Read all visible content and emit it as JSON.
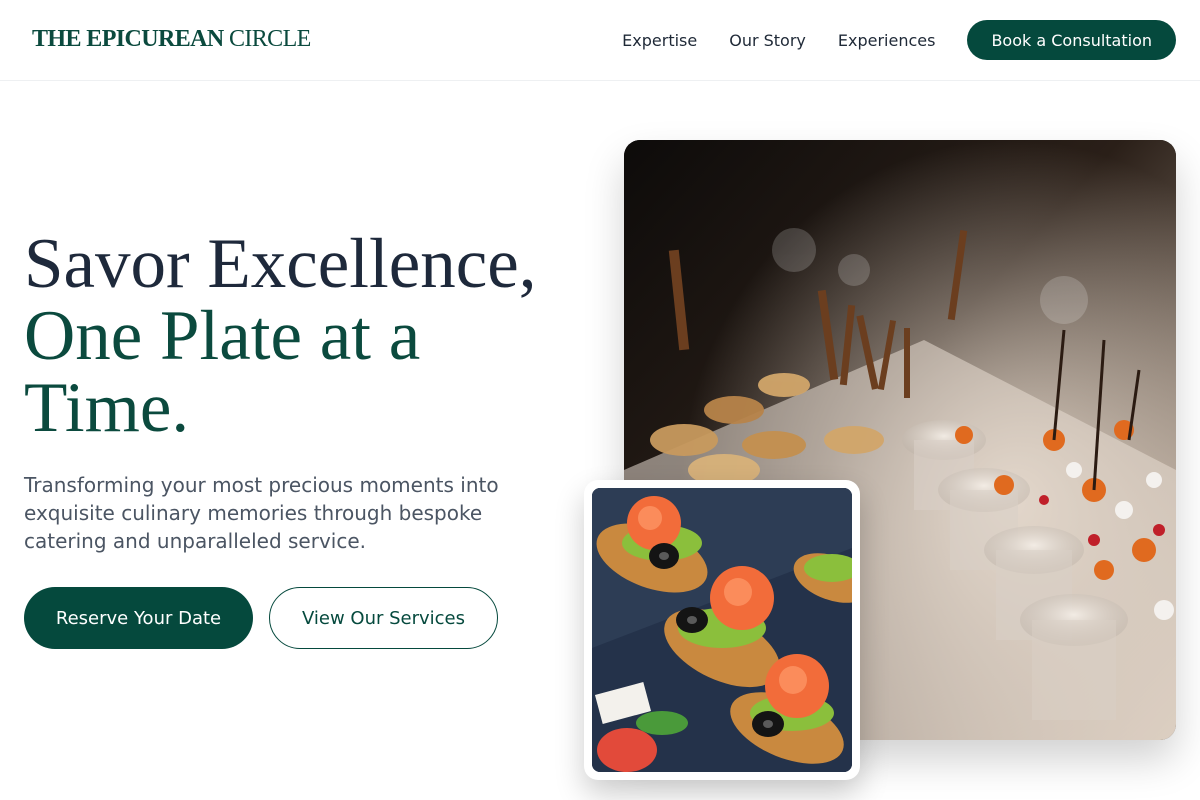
{
  "brand": {
    "bold": "THE EPICUREAN",
    "light": "CIRCLE"
  },
  "nav": {
    "links": [
      "Expertise",
      "Our Story",
      "Experiences"
    ],
    "cta": "Book a Consultation"
  },
  "hero": {
    "title_line1": "Savor Excellence,",
    "title_line2": "One Plate at a Time.",
    "subtitle": "Transforming your most precious moments into exquisite culinary memories through bespoke catering and unparalleled service.",
    "primary_button": "Reserve Your Date",
    "secondary_button": "View Our Services"
  },
  "images": {
    "main_alt": "Catering table with glass cups of desserts and canapés",
    "small_alt": "Smoked salmon rolls with olives on bread slices"
  },
  "colors": {
    "brand_green": "#05493d",
    "heading_dark": "#1e293b",
    "text_muted": "#4b5563"
  }
}
